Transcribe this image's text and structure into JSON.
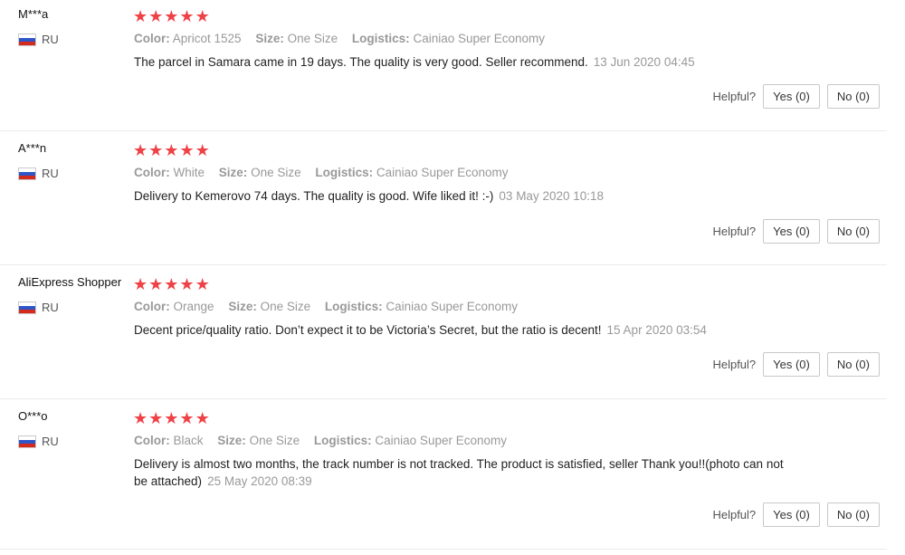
{
  "reviews": [
    {
      "user": "M***a",
      "country": "RU",
      "stars": 5,
      "color_label": "Color:",
      "color": "Apricot 1525",
      "size_label": "Size:",
      "size": "One Size",
      "logistics_label": "Logistics:",
      "logistics": "Cainiao Super Economy",
      "text": "The parcel in Samara came in 19 days. The quality is very good. Seller recommend.",
      "date": "13 Jun 2020 04:45",
      "helpful_label": "Helpful?",
      "yes": "Yes (0)",
      "no": "No (0)"
    },
    {
      "user": "A***n",
      "country": "RU",
      "stars": 5,
      "color_label": "Color:",
      "color": "White",
      "size_label": "Size:",
      "size": "One Size",
      "logistics_label": "Logistics:",
      "logistics": "Cainiao Super Economy",
      "text": "Delivery to Kemerovo 74 days. The quality is good. Wife liked it! :-)",
      "date": "03 May 2020 10:18",
      "helpful_label": "Helpful?",
      "yes": "Yes (0)",
      "no": "No (0)"
    },
    {
      "user": "AliExpress Shopper",
      "country": "RU",
      "stars": 5,
      "color_label": "Color:",
      "color": "Orange",
      "size_label": "Size:",
      "size": "One Size",
      "logistics_label": "Logistics:",
      "logistics": "Cainiao Super Economy",
      "text": "Decent price/quality ratio. Don’t expect it to be Victoria’s Secret, but the ratio is decent!",
      "date": "15 Apr 2020 03:54",
      "helpful_label": "Helpful?",
      "yes": "Yes (0)",
      "no": "No (0)"
    },
    {
      "user": "O***o",
      "country": "RU",
      "stars": 5,
      "color_label": "Color:",
      "color": "Black",
      "size_label": "Size:",
      "size": "One Size",
      "logistics_label": "Logistics:",
      "logistics": "Cainiao Super Economy",
      "text": "Delivery is almost two months, the track number is not tracked. The product is satisfied, seller Thank you!!(photo can not be attached)",
      "date": "25 May 2020 08:39",
      "helpful_label": "Helpful?",
      "yes": "Yes (0)",
      "no": "No (0)"
    }
  ],
  "colors": {
    "star": "#ee4246",
    "muted": "#999999"
  },
  "icons": {
    "flag": "russia-flag-icon",
    "star": "star-icon"
  }
}
